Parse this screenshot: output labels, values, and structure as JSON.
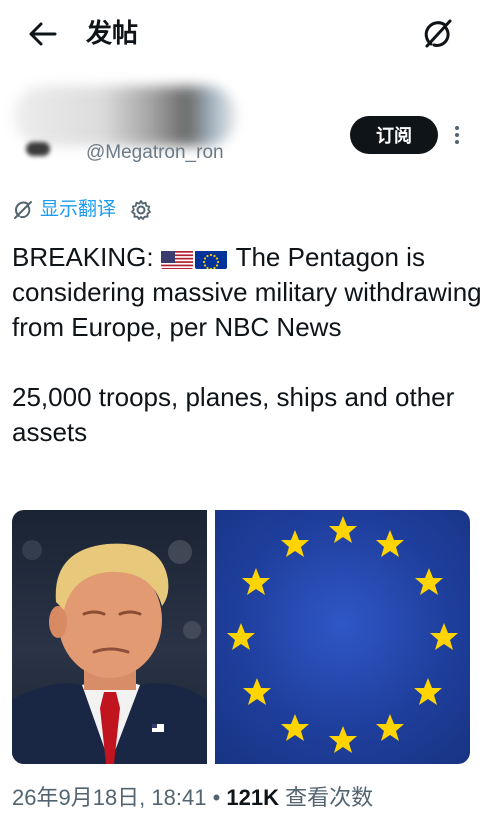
{
  "header": {
    "back_icon": "arrow-left-icon",
    "title": "发帖",
    "grok_icon": "grok-icon"
  },
  "author": {
    "handle": "@Megatron_ron",
    "subscribe_label": "订阅",
    "more_icon": "more-vertical-icon"
  },
  "translate": {
    "label": "显示翻译",
    "icon": "translate-icon",
    "settings_icon": "gear-icon"
  },
  "tweet": {
    "prefix": "BREAKING:",
    "body": "The Pentagon is considering massive military withdrawing from Europe, per NBC News\n\n25,000 troops, planes, ships and other assets",
    "flags": [
      "us-flag-icon",
      "eu-flag-icon"
    ]
  },
  "media": [
    {
      "name": "media-photo-portrait"
    },
    {
      "name": "media-photo-eu-flag"
    }
  ],
  "meta": {
    "timestamp": "26年9月18日, 18:41",
    "separator": "•",
    "views_count": "121K",
    "views_label": "查看次数"
  },
  "colors": {
    "accent": "#1d9bf0",
    "text": "#0f1419",
    "muted": "#536471",
    "button_bg": "#0f1419"
  }
}
